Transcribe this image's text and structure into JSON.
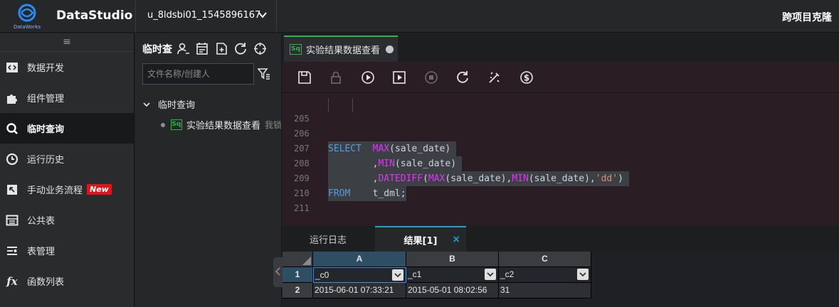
{
  "header": {
    "logo_text": "DataWorks",
    "app_title": "DataStudio",
    "project": "u_8ldsbi01_1545896167",
    "cross_project_clone": "跨项目克隆"
  },
  "leftnav": {
    "items": [
      {
        "label": "数据开发",
        "icon": "code-icon"
      },
      {
        "label": "组件管理",
        "icon": "puzzle-icon"
      },
      {
        "label": "临时查询",
        "icon": "search-icon",
        "active": true
      },
      {
        "label": "运行历史",
        "icon": "clock-icon"
      },
      {
        "label": "手动业务流程",
        "icon": "manual-flow-icon",
        "badge": "New"
      },
      {
        "label": "公共表",
        "icon": "table-icon"
      },
      {
        "label": "表管理",
        "icon": "table-manage-icon"
      },
      {
        "label": "函数列表",
        "icon": "function-icon"
      }
    ]
  },
  "panel": {
    "title": "临时查",
    "search_placeholder": "文件名称/创建人",
    "folder": "临时查询",
    "file_name": "实验结果数据查看",
    "file_owner": "我锁"
  },
  "editor": {
    "tab_icon_text": "Sq",
    "tab_title": "实验结果数据查看",
    "lines": [
      {
        "n": "205",
        "code": ""
      },
      {
        "n": "206"
      },
      {
        "n": "207"
      },
      {
        "n": "208"
      },
      {
        "n": "209"
      },
      {
        "n": "210",
        "code": ""
      },
      {
        "n": "211",
        "code": ""
      }
    ],
    "sql": {
      "select": "SELECT",
      "from": "FROM",
      "max": "MAX",
      "min": "MIN",
      "datediff": "DATEDIFF",
      "col": "sale_date",
      "unit": "'dd'",
      "table": "t_dml;"
    }
  },
  "results": {
    "tab_log": "运行日志",
    "tab_result": "结果[1]",
    "close": "×",
    "columns": [
      "A",
      "B",
      "C"
    ],
    "rows": [
      "1",
      "2"
    ],
    "header_row": [
      "_c0",
      "_c1",
      "_c2"
    ],
    "data_row": [
      "2015-06-01 07:33:21",
      "2015-05-01 08:02:56",
      "31"
    ]
  },
  "colors": {
    "accent_green": "#2fb34a",
    "accent_blue": "#1fa3c9",
    "keyword": "#569cd6",
    "function": "#d73aef",
    "string": "#ce9178",
    "badge_red": "#e3131b"
  }
}
